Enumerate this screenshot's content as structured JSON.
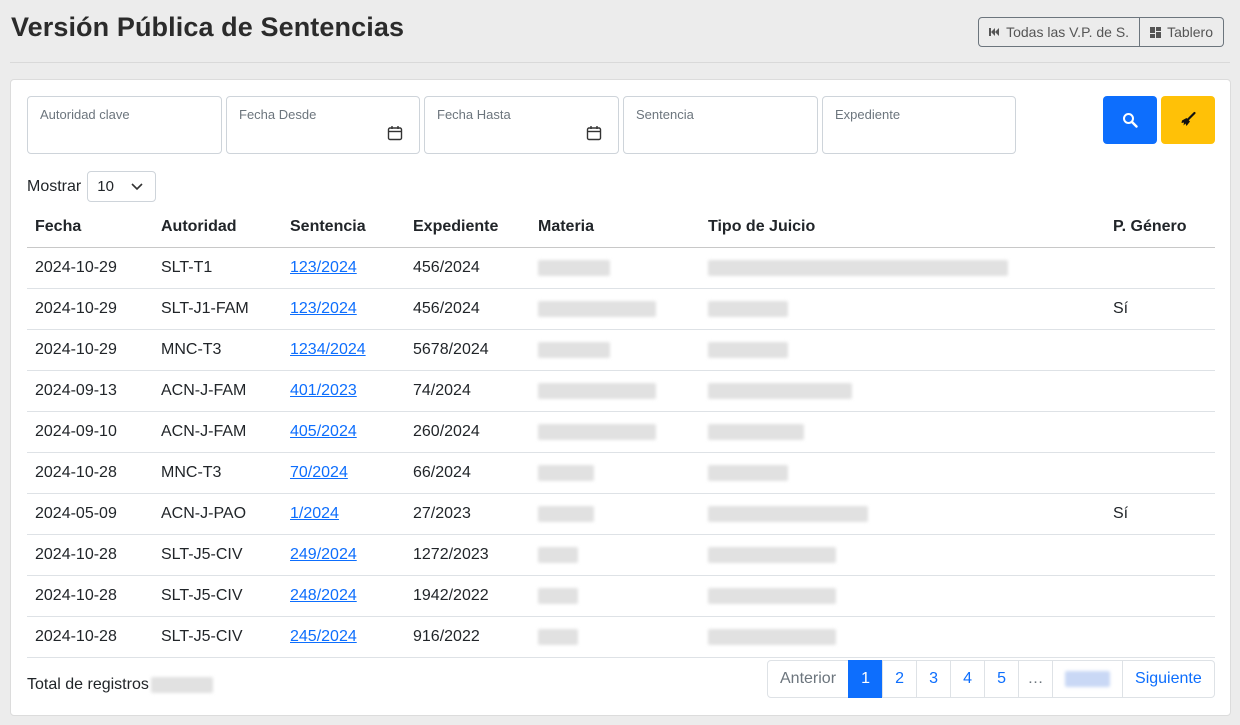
{
  "page": {
    "title": "Versión Pública de Sentencias"
  },
  "header_buttons": {
    "all_label": "Todas las V.P. de S.",
    "dashboard_label": "Tablero"
  },
  "filters": {
    "autoridad": "Autoridad clave",
    "fecha_desde": "Fecha Desde",
    "fecha_hasta": "Fecha Hasta",
    "sentencia": "Sentencia",
    "expediente": "Expediente"
  },
  "actions": {
    "search_color": "#0d6efd",
    "clear_color": "#ffc107"
  },
  "show": {
    "label": "Mostrar",
    "value": "10"
  },
  "table": {
    "columns": [
      "Fecha",
      "Autoridad",
      "Sentencia",
      "Expediente",
      "Materia",
      "Tipo de Juicio",
      "P. Género"
    ],
    "rows": [
      {
        "fecha": "2024-10-29",
        "autoridad": "SLT-T1",
        "sentencia": "123/2024",
        "expediente": "456/2024",
        "genero": ""
      },
      {
        "fecha": "2024-10-29",
        "autoridad": "SLT-J1-FAM",
        "sentencia": "123/2024",
        "expediente": "456/2024",
        "genero": "Sí"
      },
      {
        "fecha": "2024-10-29",
        "autoridad": "MNC-T3",
        "sentencia": "1234/2024",
        "expediente": "5678/2024",
        "genero": ""
      },
      {
        "fecha": "2024-09-13",
        "autoridad": "ACN-J-FAM",
        "sentencia": "401/2023",
        "expediente": "74/2024",
        "genero": ""
      },
      {
        "fecha": "2024-09-10",
        "autoridad": "ACN-J-FAM",
        "sentencia": "405/2024",
        "expediente": "260/2024",
        "genero": ""
      },
      {
        "fecha": "2024-10-28",
        "autoridad": "MNC-T3",
        "sentencia": "70/2024",
        "expediente": "66/2024",
        "genero": ""
      },
      {
        "fecha": "2024-05-09",
        "autoridad": "ACN-J-PAO",
        "sentencia": "1/2024",
        "expediente": "27/2023",
        "genero": "Sí"
      },
      {
        "fecha": "2024-10-28",
        "autoridad": "SLT-J5-CIV",
        "sentencia": "249/2024",
        "expediente": "1272/2023",
        "genero": ""
      },
      {
        "fecha": "2024-10-28",
        "autoridad": "SLT-J5-CIV",
        "sentencia": "248/2024",
        "expediente": "1942/2022",
        "genero": ""
      },
      {
        "fecha": "2024-10-28",
        "autoridad": "SLT-J5-CIV",
        "sentencia": "245/2024",
        "expediente": "916/2022",
        "genero": ""
      }
    ]
  },
  "footer": {
    "total_label": "Total de registros"
  },
  "pagination": {
    "prev": "Anterior",
    "pages": [
      "1",
      "2",
      "3",
      "4",
      "5"
    ],
    "ellipsis": "…",
    "next": "Siguiente"
  }
}
